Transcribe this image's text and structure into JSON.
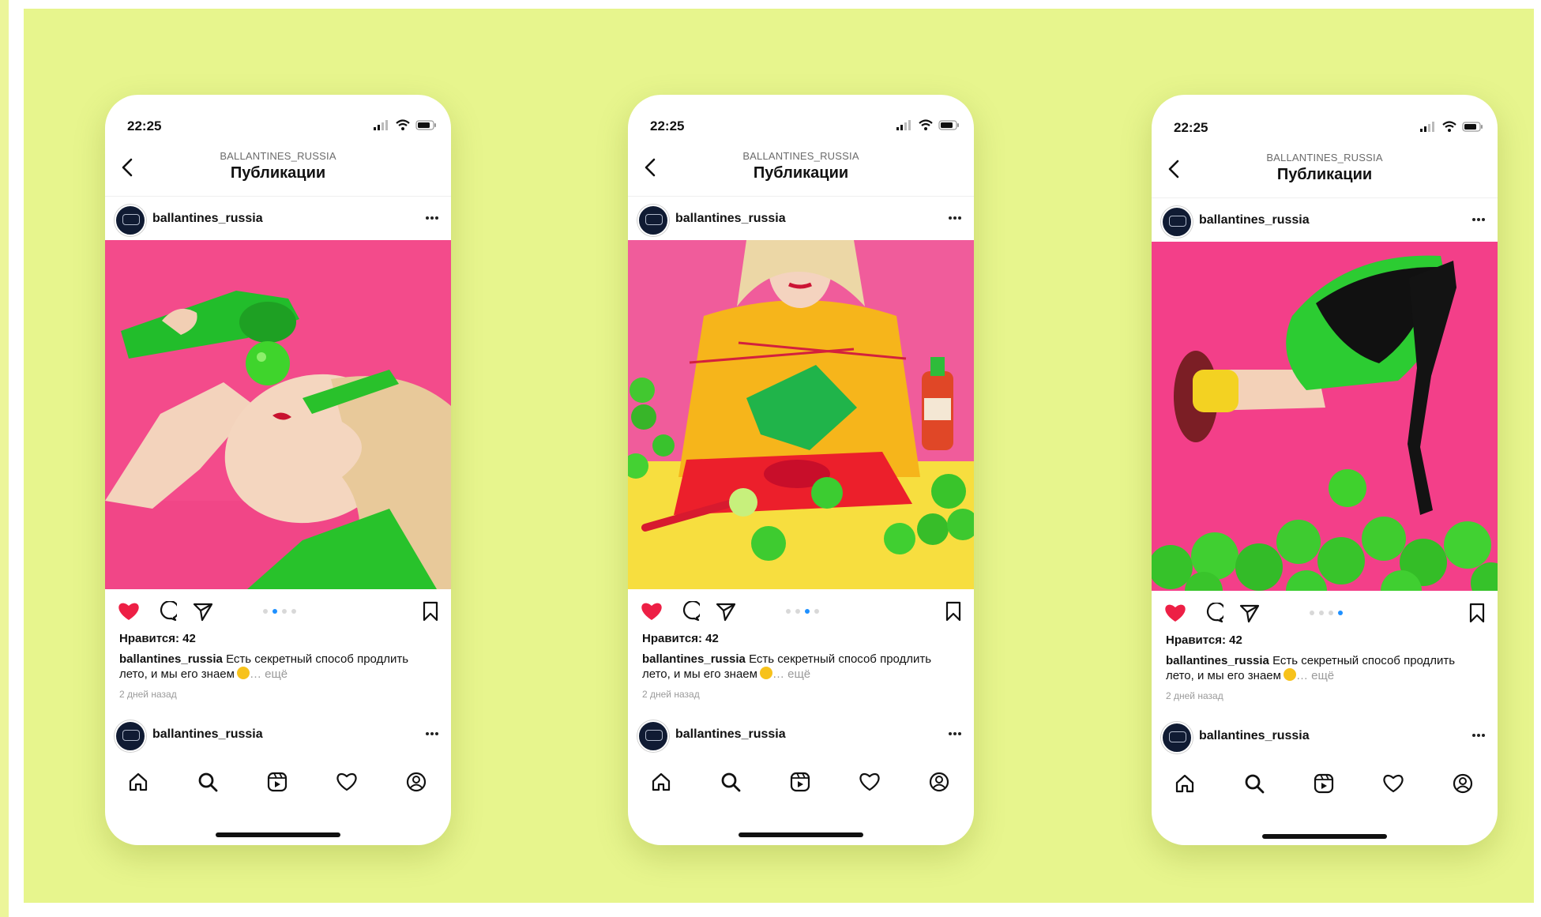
{
  "phones": [
    {
      "status_time": "22:25",
      "account_caption": "BALLANTINES_RUSSIA",
      "page_title": "Публикации",
      "username": "ballantines_russia",
      "likes": "Нравится: 42",
      "caption_user": "ballantines_russia",
      "caption_text": " Есть секретный способ продлить лето, и мы его знаем",
      "caption_more": "… ещё",
      "time_ago": "2 дней назад",
      "next_username": "ballantines_russia",
      "carousel_active": 2
    },
    {
      "status_time": "22:25",
      "account_caption": "BALLANTINES_RUSSIA",
      "page_title": "Публикации",
      "username": "ballantines_russia",
      "likes": "Нравится: 42",
      "caption_user": "ballantines_russia",
      "caption_text": " Есть секретный способ продлить лето, и мы его знаем",
      "caption_more": "… ещё",
      "time_ago": "2 дней назад",
      "next_username": "ballantines_russia",
      "carousel_active": 3
    },
    {
      "status_time": "22:25",
      "account_caption": "BALLANTINES_RUSSIA",
      "page_title": "Публикации",
      "username": "ballantines_russia",
      "likes": "Нравится: 42",
      "caption_user": "ballantines_russia",
      "caption_text": " Есть секретный способ продлить лето, и мы его знаем",
      "caption_more": "… ещё",
      "time_ago": "2 дней назад",
      "next_username": "ballantines_russia",
      "carousel_active": 4
    }
  ],
  "colors": {
    "background": "#e7f58d",
    "photo_pink": "#f34b8b",
    "lime_green": "#2fc629",
    "like_red": "#ed1f45",
    "carousel_active": "#1e90ff"
  },
  "icons": {
    "status": [
      "signal-icon",
      "wifi-icon",
      "battery-icon"
    ],
    "header": [
      "back-chevron-icon"
    ],
    "post_actions": [
      "heart-icon",
      "comment-icon",
      "share-icon",
      "bookmark-icon"
    ],
    "bottom_nav": [
      "home-icon",
      "search-icon",
      "reels-icon",
      "activity-heart-icon",
      "profile-icon"
    ]
  }
}
